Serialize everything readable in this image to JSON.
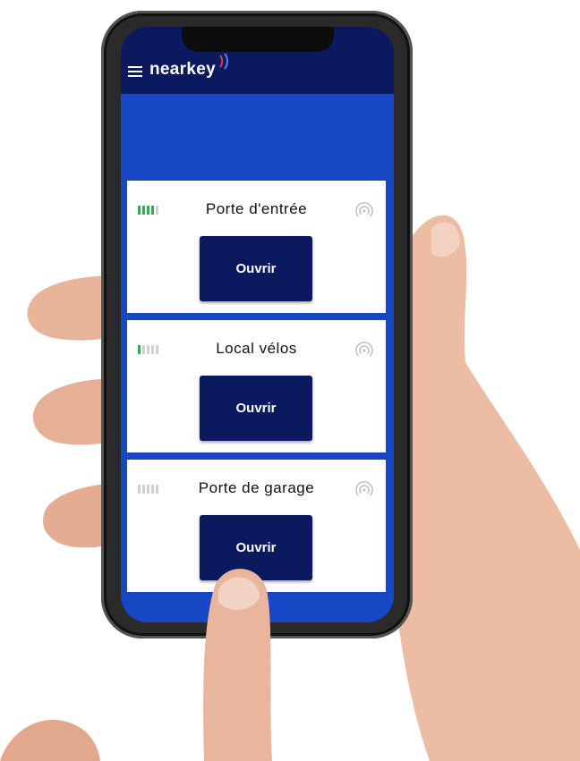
{
  "app": {
    "brand": "nearkey",
    "menu_icon": "hamburger-menu-icon"
  },
  "colors": {
    "appbar": "#0b1a5e",
    "background": "#1747c4",
    "card": "#ffffff",
    "button": "#0b1a5e",
    "signal_on": "#34a853",
    "signal_off": "#d0d0d0"
  },
  "doors": [
    {
      "name": "Porte d'entrée",
      "button_label": "Ouvrir",
      "signal_level": 4,
      "signal_max": 5,
      "icon": "nfc-signal-icon"
    },
    {
      "name": "Local vélos",
      "button_label": "Ouvrir",
      "signal_level": 1,
      "signal_max": 5,
      "icon": "nfc-signal-icon"
    },
    {
      "name": "Porte de garage",
      "button_label": "Ouvrir",
      "signal_level": 0,
      "signal_max": 5,
      "icon": "nfc-signal-icon"
    }
  ]
}
